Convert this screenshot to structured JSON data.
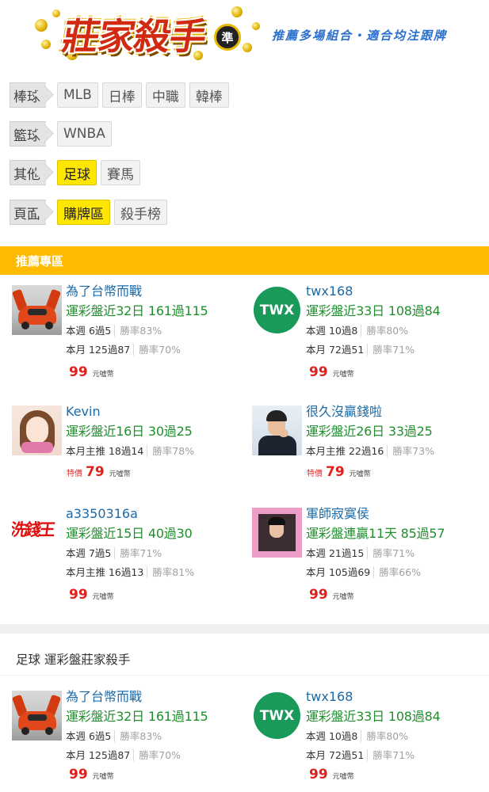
{
  "header": {
    "logo_text": "莊家殺手",
    "logo_badge": "準",
    "slogan": "推薦多場組合・適合均注跟牌"
  },
  "nav": [
    {
      "category": "棒球",
      "items": [
        {
          "label": "MLB",
          "active": false
        },
        {
          "label": "日棒",
          "active": false
        },
        {
          "label": "中職",
          "active": false
        },
        {
          "label": "韓棒",
          "active": false
        }
      ]
    },
    {
      "category": "籃球",
      "items": [
        {
          "label": "WNBA",
          "active": false
        }
      ]
    },
    {
      "category": "其他",
      "items": [
        {
          "label": "足球",
          "active": true
        },
        {
          "label": "賽馬",
          "active": false
        }
      ]
    },
    {
      "category": "頁面",
      "items": [
        {
          "label": "購牌區",
          "active": true
        },
        {
          "label": "殺手榜",
          "active": false
        }
      ]
    }
  ],
  "recommend": {
    "title": "推薦專區",
    "cards": [
      {
        "name": "為了台幣而戰",
        "record": "運彩盤近32日 161過115",
        "stat1": "本週 6過5",
        "rate1": "勝率83%",
        "stat2": "本月 125過87",
        "rate2": "勝率70%",
        "special": "",
        "price": "99",
        "unit": "元噓幣",
        "avatar": "car-avatar"
      },
      {
        "name": "twx168",
        "record": "運彩盤近33日 108過84",
        "stat1": "本週 10過8",
        "rate1": "勝率80%",
        "stat2": "本月 72過51",
        "rate2": "勝率71%",
        "special": "",
        "price": "99",
        "unit": "元噓幣",
        "avatar": "twx-avatar",
        "avatar_text": "TWX"
      },
      {
        "name": "Kevin",
        "record": "運彩盤近16日 30過25",
        "stat1": "本月主推 18過14",
        "rate1": "勝率78%",
        "stat2": "",
        "rate2": "",
        "special": "特價",
        "price": "79",
        "unit": "元噓幣",
        "avatar": "girl-avatar"
      },
      {
        "name": "很久沒贏錢啦",
        "record": "運彩盤近26日 33過25",
        "stat1": "本月主推 22過16",
        "rate1": "勝率73%",
        "stat2": "",
        "rate2": "",
        "special": "特價",
        "price": "79",
        "unit": "元噓幣",
        "avatar": "man-avatar"
      },
      {
        "name": "a3350316a",
        "record": "運彩盤近15日 40過30",
        "stat1": "本週 7過5",
        "rate1": "勝率71%",
        "stat2": "本月主推 16過13",
        "rate2": "勝率81%",
        "special": "",
        "price": "99",
        "unit": "元噓幣",
        "avatar": "xiqianwang-avatar",
        "avatar_text": "洗錢王"
      },
      {
        "name": "軍師寂寞侯",
        "record": "運彩盤連贏11天 85過57",
        "stat1": "本週 21過15",
        "rate1": "勝率71%",
        "stat2": "本月 105過69",
        "rate2": "勝率66%",
        "special": "",
        "price": "99",
        "unit": "元噓幣",
        "avatar": "pink-frame-avatar"
      }
    ]
  },
  "section2": {
    "title": "足球 運彩盤莊家殺手",
    "cards": [
      {
        "name": "為了台幣而戰",
        "record": "運彩盤近32日 161過115",
        "stat1": "本週 6過5",
        "rate1": "勝率83%",
        "stat2": "本月 125過87",
        "rate2": "勝率70%",
        "price": "99",
        "unit": "元噓幣",
        "avatar": "car-avatar"
      },
      {
        "name": "twx168",
        "record": "運彩盤近33日 108過84",
        "stat1": "本週 10過8",
        "rate1": "勝率80%",
        "stat2": "本月 72過51",
        "rate2": "勝率71%",
        "price": "99",
        "unit": "元噓幣",
        "avatar": "twx-avatar",
        "avatar_text": "TWX"
      }
    ]
  },
  "colors": {
    "accent_yellow": "#ffbb00",
    "active_tab": "#ffe600",
    "name_blue": "#1a6aa8",
    "record_green": "#1f8f2c",
    "price_red": "#e0201c"
  }
}
